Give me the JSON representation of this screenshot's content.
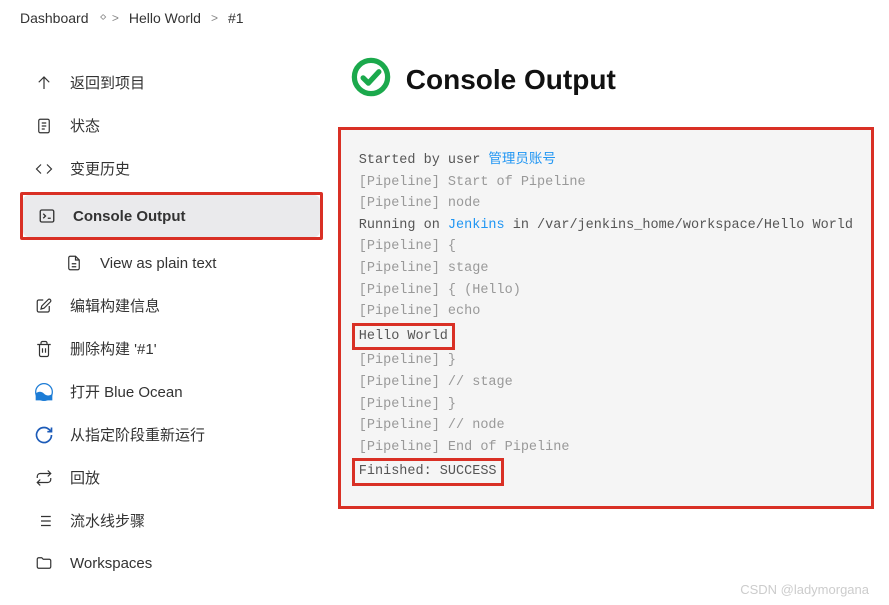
{
  "breadcrumb": {
    "items": [
      "Dashboard",
      "Hello World",
      "#1"
    ]
  },
  "sidebar": {
    "back": "返回到项目",
    "status": "状态",
    "changes": "变更历史",
    "console": "Console Output",
    "plaintext": "View as plain text",
    "editBuild": "编辑构建信息",
    "deleteBuild": "删除构建 '#1'",
    "blueOcean": "打开 Blue Ocean",
    "restartStage": "从指定阶段重新运行",
    "replay": "回放",
    "pipelineSteps": "流水线步骤",
    "workspaces": "Workspaces"
  },
  "page": {
    "title": "Console Output"
  },
  "console": {
    "startedBy": "Started by user ",
    "userLink": "管理员账号",
    "lines1": [
      "[Pipeline] Start of Pipeline",
      "[Pipeline] node"
    ],
    "runningOn": "Running on ",
    "jenkinsLink": "Jenkins",
    "runningIn": " in /var/jenkins_home/workspace/Hello World",
    "lines2": [
      "[Pipeline] {",
      "[Pipeline] stage",
      "[Pipeline] { (Hello)",
      "[Pipeline] echo"
    ],
    "helloWorld": "Hello World",
    "lines3": [
      "[Pipeline] }",
      "[Pipeline] // stage",
      "[Pipeline] }",
      "[Pipeline] // node",
      "[Pipeline] End of Pipeline"
    ],
    "finished": "Finished: SUCCESS"
  },
  "watermark": "CSDN @ladymorgana"
}
